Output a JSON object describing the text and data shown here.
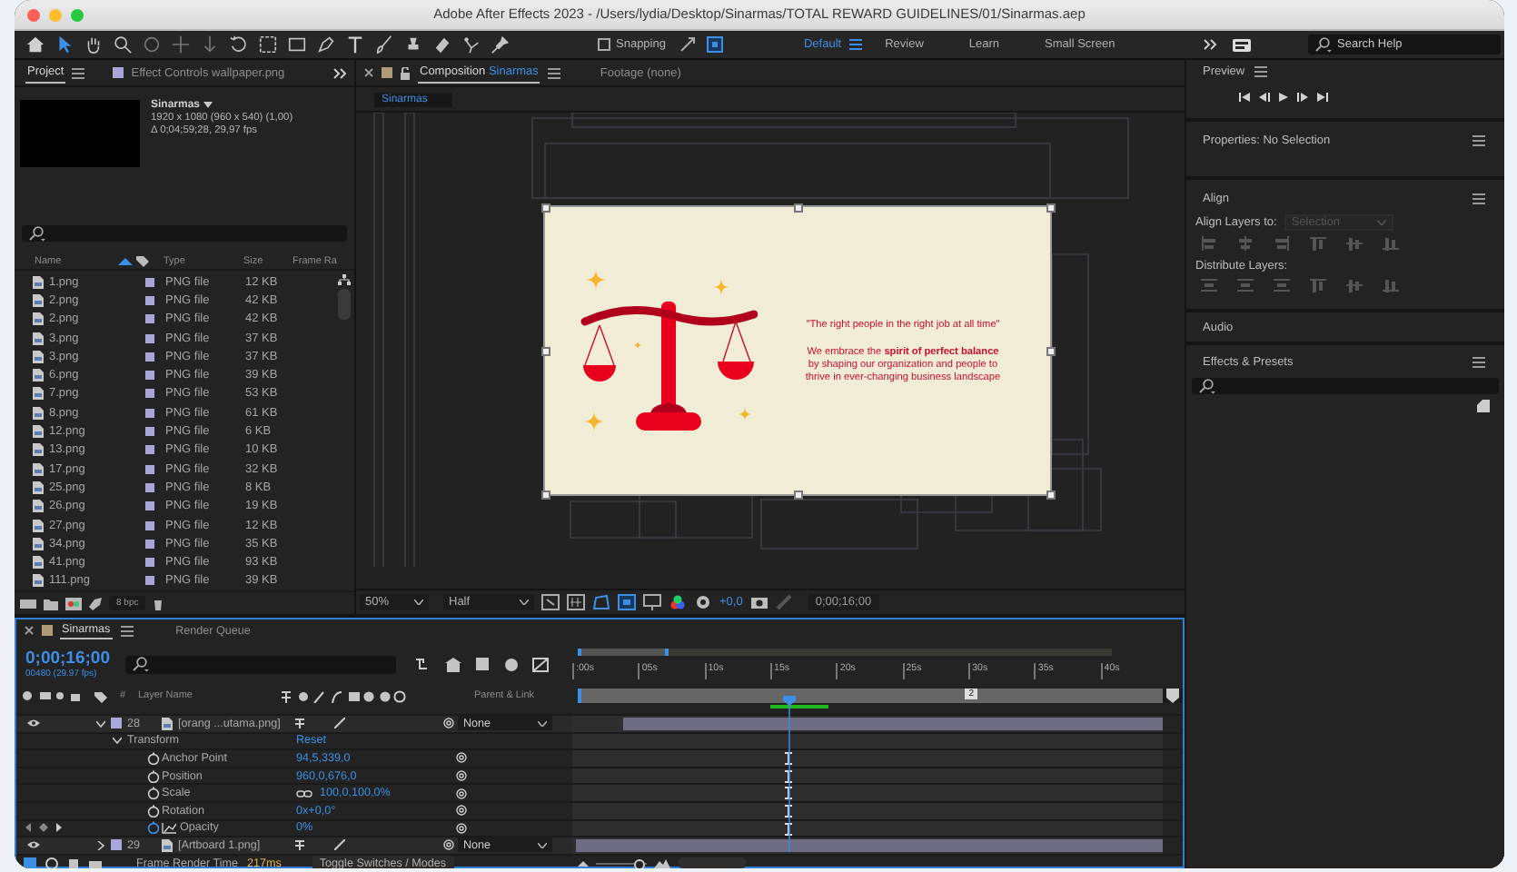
{
  "window": {
    "title": "Adobe After Effects 2023 - /Users/lydia/Desktop/Sinarmas/TOTAL REWARD GUIDELINES/01/Sinarmas.aep"
  },
  "toolbar": {
    "snapping": {
      "label": "Snapping",
      "checked": false
    },
    "workspaces": [
      {
        "label": "Default",
        "selected": true
      },
      {
        "label": "Review",
        "selected": false
      },
      {
        "label": "Learn",
        "selected": false
      },
      {
        "label": "Small Screen",
        "selected": false
      }
    ],
    "search": {
      "placeholder": "Search Help"
    }
  },
  "project": {
    "tabs": [
      {
        "label": "Project",
        "selected": true
      },
      {
        "label": "Effect Controls wallpaper.png",
        "selected": false
      }
    ],
    "comp_name": "Sinarmas",
    "comp_info": [
      "1920 x 1080  (960 x 540) (1,00)",
      "Δ 0;04;59;28, 29,97 fps"
    ],
    "columns": [
      "Name",
      "Type",
      "Size",
      "Frame Ra"
    ],
    "rows": [
      {
        "name": "1.png",
        "type": "PNG file",
        "size": "12 KB"
      },
      {
        "name": "2.png",
        "type": "PNG file",
        "size": "42 KB"
      },
      {
        "name": "2.png",
        "type": "PNG file",
        "size": "42 KB"
      },
      {
        "name": "3.png",
        "type": "PNG file",
        "size": "37 KB"
      },
      {
        "name": "3.png",
        "type": "PNG file",
        "size": "37 KB"
      },
      {
        "name": "6.png",
        "type": "PNG file",
        "size": "39 KB"
      },
      {
        "name": "7.png",
        "type": "PNG file",
        "size": "53 KB"
      },
      {
        "name": "8.png",
        "type": "PNG file",
        "size": "61 KB"
      },
      {
        "name": "12.png",
        "type": "PNG file",
        "size": "6 KB"
      },
      {
        "name": "13.png",
        "type": "PNG file",
        "size": "10 KB"
      },
      {
        "name": "17.png",
        "type": "PNG file",
        "size": "32 KB"
      },
      {
        "name": "25.png",
        "type": "PNG file",
        "size": "8 KB"
      },
      {
        "name": "26.png",
        "type": "PNG file",
        "size": "19 KB"
      },
      {
        "name": "27.png",
        "type": "PNG file",
        "size": "12 KB"
      },
      {
        "name": "34.png",
        "type": "PNG file",
        "size": "35 KB"
      },
      {
        "name": "41.png",
        "type": "PNG file",
        "size": "93 KB"
      },
      {
        "name": "111.png",
        "type": "PNG file",
        "size": "39 KB"
      }
    ],
    "bpc": "8 bpc"
  },
  "composition": {
    "tabs": [
      {
        "label": "Composition",
        "comp": "Sinarmas",
        "selected": true
      },
      {
        "label": "Footage (none)",
        "selected": false
      }
    ],
    "breadcrumb": "Sinarmas",
    "slide": {
      "quote": "\"The right people in the right job at all time\"",
      "body": [
        "We embrace the **spirit of perfect balance**",
        "by shaping our organization and people to",
        "thrive in ever-changing business landscape"
      ]
    },
    "zoom": "50%",
    "resolution": "Half",
    "exposure": "+0,0",
    "timecode": "0;00;16;00"
  },
  "right": {
    "preview": "Preview",
    "properties": "Properties: No Selection",
    "align": {
      "title": "Align",
      "align_to": "Align Layers to:",
      "align_to_value": "Selection",
      "distribute": "Distribute Layers:"
    },
    "audio": "Audio",
    "effects": "Effects & Presets"
  },
  "timeline": {
    "tabs": [
      {
        "label": "Sinarmas",
        "selected": true
      },
      {
        "label": "Render Queue",
        "selected": false
      }
    ],
    "timecode": "0;00;16;00",
    "frame_info": "00480 (29.97 fps)",
    "columns": {
      "number": "#",
      "layer_name": "Layer Name",
      "parent": "Parent & Link"
    },
    "rows": [
      {
        "kind": "layer",
        "number": "28",
        "name": "[orang ...utama.png]",
        "expanded": true,
        "parent": "None",
        "level": 0.92
      },
      {
        "kind": "group",
        "name": "Transform",
        "value": "Reset"
      },
      {
        "kind": "property",
        "name": "Anchor Point",
        "value": "94,5,339,0",
        "animated": false,
        "linked": false,
        "keyframe": true
      },
      {
        "kind": "property",
        "name": "Position",
        "value": "960,0,676,0",
        "animated": false,
        "linked": false,
        "keyframe": true
      },
      {
        "kind": "property",
        "name": "Scale",
        "value": "100,0,100,0%",
        "animated": false,
        "linked": true,
        "keyframe": true
      },
      {
        "kind": "property",
        "name": "Rotation",
        "value": "0x+0,0°",
        "animated": false,
        "linked": false,
        "keyframe": true
      },
      {
        "kind": "property",
        "name": "Opacity",
        "value": "0%",
        "animated": true,
        "linked": false,
        "keyframe": true
      },
      {
        "kind": "layer",
        "number": "29",
        "name": "[Artboard 1.png]",
        "expanded": false,
        "parent": "None",
        "level": 1
      }
    ],
    "ruler": [
      ":00s",
      "05s",
      "10s",
      "15s",
      "20s",
      "25s",
      "30s",
      "35s",
      "40s"
    ],
    "playhead": {
      "level": 0.36
    },
    "marker": "2",
    "zoom_slider": {
      "level": 0.85
    },
    "render_time_label": "Frame Render Time",
    "render_time": "217ms",
    "toggle": "Toggle Switches / Modes"
  }
}
